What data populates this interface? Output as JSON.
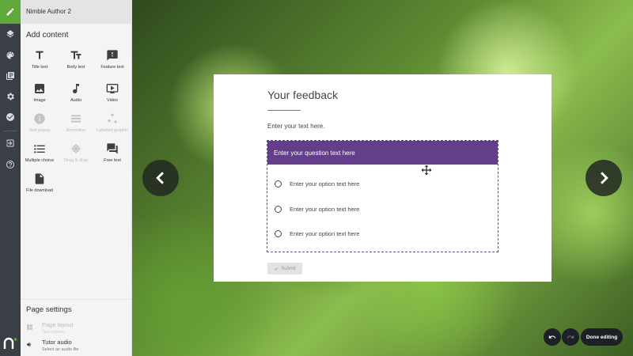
{
  "app": {
    "title": "Nimble Author 2"
  },
  "add_content": {
    "title": "Add content",
    "tools": [
      {
        "label": "Title text",
        "icon": "title-text-icon",
        "enabled": true
      },
      {
        "label": "Body text",
        "icon": "body-text-icon",
        "enabled": true
      },
      {
        "label": "Feature text",
        "icon": "feature-text-icon",
        "enabled": true
      },
      {
        "label": "Image",
        "icon": "image-icon",
        "enabled": true
      },
      {
        "label": "Audio",
        "icon": "audio-icon",
        "enabled": true
      },
      {
        "label": "Video",
        "icon": "video-icon",
        "enabled": true
      },
      {
        "label": "Text popup",
        "icon": "info-icon",
        "enabled": false
      },
      {
        "label": "Accordion",
        "icon": "accordion-icon",
        "enabled": false
      },
      {
        "label": "Labelled graphic",
        "icon": "labelled-graphic-icon",
        "enabled": false
      },
      {
        "label": "Multiple choice",
        "icon": "list-icon",
        "enabled": true
      },
      {
        "label": "Drag & drop",
        "icon": "target-icon",
        "enabled": false
      },
      {
        "label": "Free text",
        "icon": "chat-icon",
        "enabled": true
      },
      {
        "label": "File download",
        "icon": "file-icon",
        "enabled": true
      }
    ]
  },
  "page_settings": {
    "title": "Page settings",
    "page_layout": {
      "label": "Page layout",
      "sub": "Text column"
    },
    "tutor_audio": {
      "label": "Tutor audio",
      "sub": "Select an audio file"
    }
  },
  "card": {
    "title": "Your feedback",
    "intro": "Enter your text here.",
    "question": "Enter your question text here",
    "options": [
      "Enter your option text here",
      "Enter your option text here",
      "Enter your option text here"
    ],
    "submit_label": "Submit"
  },
  "controls": {
    "done_label": "Done editing"
  },
  "colors": {
    "accent_green": "#5fa83a",
    "question_purple": "#623f88",
    "rail": "#3a3f46"
  }
}
